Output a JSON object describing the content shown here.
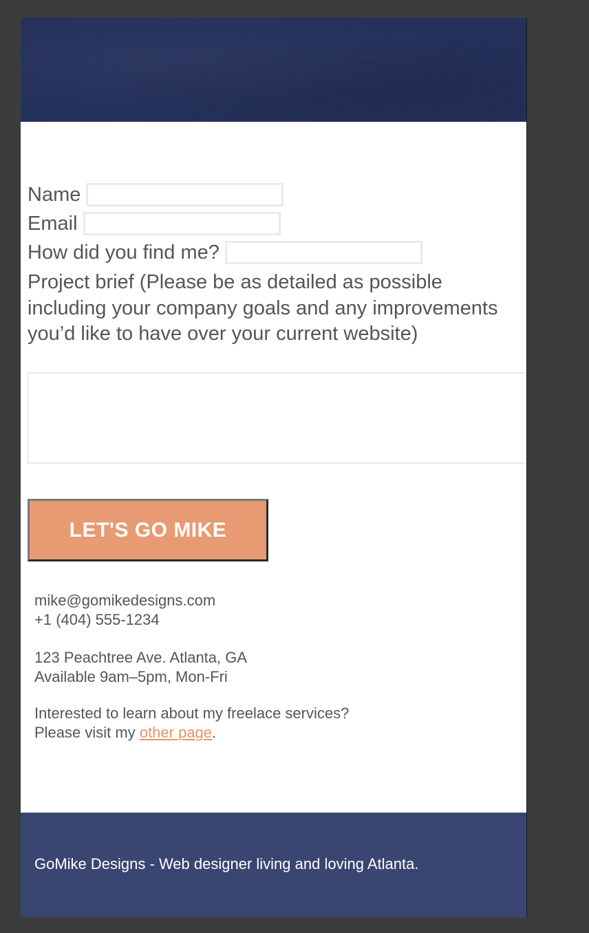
{
  "form": {
    "name_label": "Name",
    "email_label": "Email",
    "source_label": "How did you find me?",
    "brief_label": "Project brief (Please be as detailed as possible including your company goals and any improvements you’d like to have over your current website)",
    "submit_label": "LET'S GO MIKE"
  },
  "contact": {
    "email": "mike@gomikedesigns.com",
    "phone": "+1 (404) 555-1234",
    "address": "123 Peachtree Ave. Atlanta, GA",
    "hours": "Available 9am–5pm, Mon-Fri",
    "freelance_question": "Interested to learn about my freelace services?",
    "visit_prefix": "Please visit my ",
    "visit_link": "other page",
    "visit_suffix": "."
  },
  "footer": {
    "text": "GoMike Designs - Web designer living and loving Atlanta."
  },
  "colors": {
    "header_bg": "#23305a",
    "footer_bg": "#3a4672",
    "accent": "#e89a73",
    "text": "#555555"
  }
}
